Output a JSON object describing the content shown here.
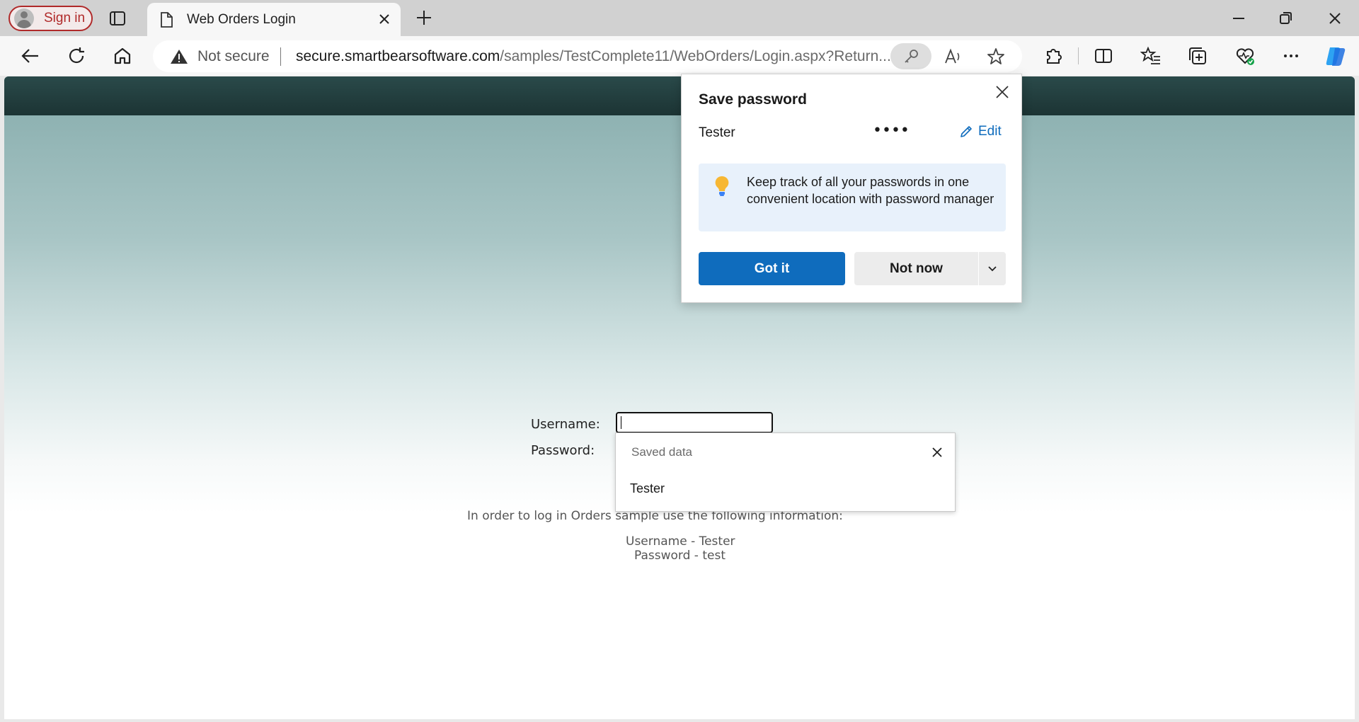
{
  "browser": {
    "signin_label": "Sign in",
    "tab_title": "Web Orders Login",
    "address": {
      "security_label": "Not secure",
      "host": "secure.smartbearsoftware.com",
      "path": "/samples/TestComplete11/WebOrders/Login.aspx?Return..."
    }
  },
  "page": {
    "username_label": "Username:",
    "password_label": "Password:",
    "info_line": "In order to log in Orders sample use the following information:",
    "info_username": "Username - Tester",
    "info_password": "Password - test"
  },
  "autofill": {
    "header": "Saved data",
    "items": [
      "Tester"
    ]
  },
  "save_password": {
    "title": "Save password",
    "username": "Tester",
    "password_mask": "••••",
    "edit_label": "Edit",
    "tip": "Keep track of all your passwords in one convenient location with password manager",
    "primary_button": "Got it",
    "secondary_button": "Not now"
  },
  "colors": {
    "accent": "#0f6cbd",
    "header_bar": "#1c3434",
    "signin": "#b02a2a"
  },
  "icons": [
    "avatar-icon",
    "tab-actions-icon",
    "page-icon",
    "close-icon",
    "plus-icon",
    "minimize-icon",
    "restore-icon",
    "back-icon",
    "refresh-icon",
    "home-icon",
    "warning-icon",
    "key-icon",
    "read-aloud-icon",
    "favorite-star-icon",
    "extensions-icon",
    "split-screen-icon",
    "favorites-icon",
    "collections-icon",
    "browser-essentials-icon",
    "more-icon",
    "copilot-icon",
    "pencil-icon",
    "lightbulb-icon",
    "chevron-down-icon"
  ]
}
